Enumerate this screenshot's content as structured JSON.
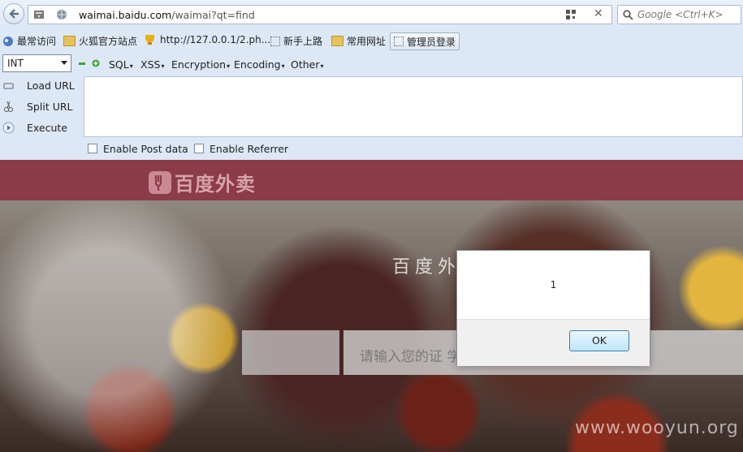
{
  "browser": {
    "url_host": "waimai.baidu.com",
    "url_path": "/waimai?qt=find",
    "search_placeholder": "Google <Ctrl+K>",
    "clear_symbol": "✕"
  },
  "bookmarks": [
    {
      "label": "最常访问",
      "icon": "globe-icon"
    },
    {
      "label": "火狐官方站点",
      "icon": "folder-icon"
    },
    {
      "label": "http://127.0.0.1/2.ph...",
      "icon": "trophy-icon"
    },
    {
      "label": "新手上路",
      "icon": "dotted-page-icon"
    },
    {
      "label": "常用网址",
      "icon": "folder-icon"
    },
    {
      "label": "管理员登录",
      "icon": "dotted-page-icon"
    }
  ],
  "hackbar": {
    "type_select": "INT",
    "menus": [
      "SQL",
      "XSS",
      "Encryption",
      "Encoding",
      "Other"
    ],
    "buttons": [
      "Load URL",
      "Split URL",
      "Execute"
    ],
    "enable_post": "Enable Post data",
    "enable_referrer": "Enable Referrer"
  },
  "page": {
    "logo_text": "百度外卖",
    "slogan": "百度外         卖外卖",
    "search_placeholder": "请输入您的证                                     学校等）",
    "watermark": "www.wooyun.org"
  },
  "alert": {
    "message": "1",
    "ok_label": "OK"
  },
  "colors": {
    "header_bg": "#8c3b48",
    "toolbar_bg": "#dde8f6"
  }
}
